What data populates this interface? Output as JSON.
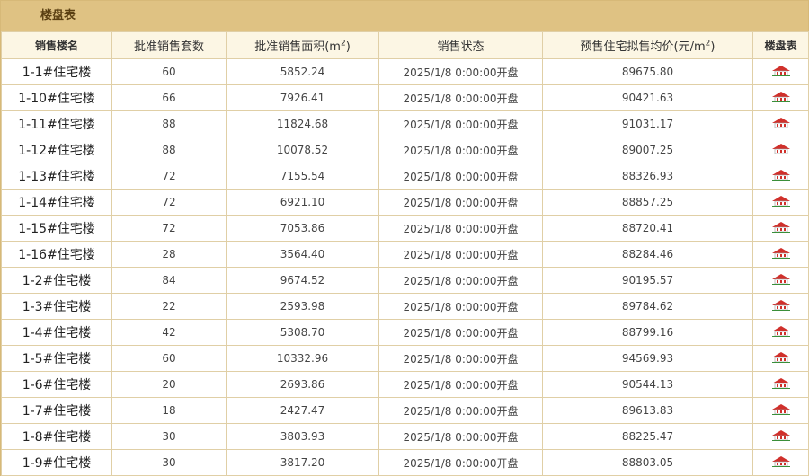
{
  "panel": {
    "title": "楼盘表"
  },
  "table": {
    "headers": {
      "name": "销售楼名",
      "units": "批准销售套数",
      "area": "批准销售面积(m",
      "area_sup": "2",
      "area_close": ")",
      "status": "销售状态",
      "price": "预售住宅拟售均价(元/m",
      "price_sup": "2",
      "price_close": ")",
      "plan": "楼盘表"
    },
    "rows": [
      {
        "name": "1-1#住宅楼",
        "units": "60",
        "area": "5852.24",
        "status": "2025/1/8 0:00:00开盘",
        "price": "89675.80"
      },
      {
        "name": "1-10#住宅楼",
        "units": "66",
        "area": "7926.41",
        "status": "2025/1/8 0:00:00开盘",
        "price": "90421.63"
      },
      {
        "name": "1-11#住宅楼",
        "units": "88",
        "area": "11824.68",
        "status": "2025/1/8 0:00:00开盘",
        "price": "91031.17"
      },
      {
        "name": "1-12#住宅楼",
        "units": "88",
        "area": "10078.52",
        "status": "2025/1/8 0:00:00开盘",
        "price": "89007.25"
      },
      {
        "name": "1-13#住宅楼",
        "units": "72",
        "area": "7155.54",
        "status": "2025/1/8 0:00:00开盘",
        "price": "88326.93"
      },
      {
        "name": "1-14#住宅楼",
        "units": "72",
        "area": "6921.10",
        "status": "2025/1/8 0:00:00开盘",
        "price": "88857.25"
      },
      {
        "name": "1-15#住宅楼",
        "units": "72",
        "area": "7053.86",
        "status": "2025/1/8 0:00:00开盘",
        "price": "88720.41"
      },
      {
        "name": "1-16#住宅楼",
        "units": "28",
        "area": "3564.40",
        "status": "2025/1/8 0:00:00开盘",
        "price": "88284.46"
      },
      {
        "name": "1-2#住宅楼",
        "units": "84",
        "area": "9674.52",
        "status": "2025/1/8 0:00:00开盘",
        "price": "90195.57"
      },
      {
        "name": "1-3#住宅楼",
        "units": "22",
        "area": "2593.98",
        "status": "2025/1/8 0:00:00开盘",
        "price": "89784.62"
      },
      {
        "name": "1-4#住宅楼",
        "units": "42",
        "area": "5308.70",
        "status": "2025/1/8 0:00:00开盘",
        "price": "88799.16"
      },
      {
        "name": "1-5#住宅楼",
        "units": "60",
        "area": "10332.96",
        "status": "2025/1/8 0:00:00开盘",
        "price": "94569.93"
      },
      {
        "name": "1-6#住宅楼",
        "units": "20",
        "area": "2693.86",
        "status": "2025/1/8 0:00:00开盘",
        "price": "90544.13"
      },
      {
        "name": "1-7#住宅楼",
        "units": "18",
        "area": "2427.47",
        "status": "2025/1/8 0:00:00开盘",
        "price": "89613.83"
      },
      {
        "name": "1-8#住宅楼",
        "units": "30",
        "area": "3803.93",
        "status": "2025/1/8 0:00:00开盘",
        "price": "88225.47"
      },
      {
        "name": "1-9#住宅楼",
        "units": "30",
        "area": "3817.20",
        "status": "2025/1/8 0:00:00开盘",
        "price": "88803.05"
      }
    ],
    "plan_icon": "house-icon",
    "colors": {
      "roof": "#d0302b",
      "wall": "#ffffff",
      "ground": "#3a8f3a",
      "accent": "#dfc283"
    }
  }
}
